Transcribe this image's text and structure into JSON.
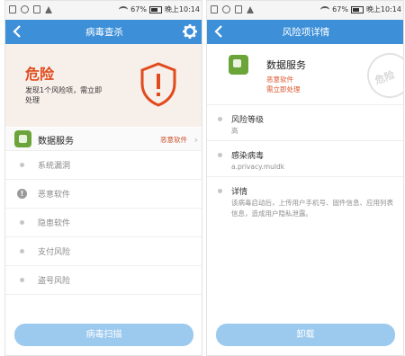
{
  "status_bar": {
    "battery": "67%",
    "time": "晚上10:14"
  },
  "left": {
    "title": "病毒查杀",
    "danger": {
      "title": "危险",
      "description": "发现1个风险项，需立即处理"
    },
    "list": [
      {
        "label": "数据服务",
        "tag": "恶意软件",
        "icon": "app-icon"
      },
      {
        "label": "系统漏洞",
        "icon": "dot"
      },
      {
        "label": "恶意软件",
        "icon": "warning-icon"
      },
      {
        "label": "隐患软件",
        "icon": "dot"
      },
      {
        "label": "支付风险",
        "icon": "dot"
      },
      {
        "label": "盗号风险",
        "icon": "dot"
      }
    ],
    "scan_button": "病毒扫描"
  },
  "right": {
    "title": "风险项详情",
    "app": {
      "name": "数据服务",
      "risk_line1": "恶意软件",
      "risk_line2": "需立即处理",
      "stamp": "危险"
    },
    "sections": [
      {
        "title": "风险等级",
        "value": "高"
      },
      {
        "title": "感染病毒",
        "value": "a.privacy.muldk"
      },
      {
        "title": "详情",
        "value": "该病毒启动后，上传用户手机号、固件信息、应用列表信息，造成用户隐私泄露。"
      }
    ],
    "uninstall_button": "卸载"
  },
  "colors": {
    "accent": "#3d8fd8",
    "danger": "#e14a1c",
    "button": "#9cc9ee"
  }
}
